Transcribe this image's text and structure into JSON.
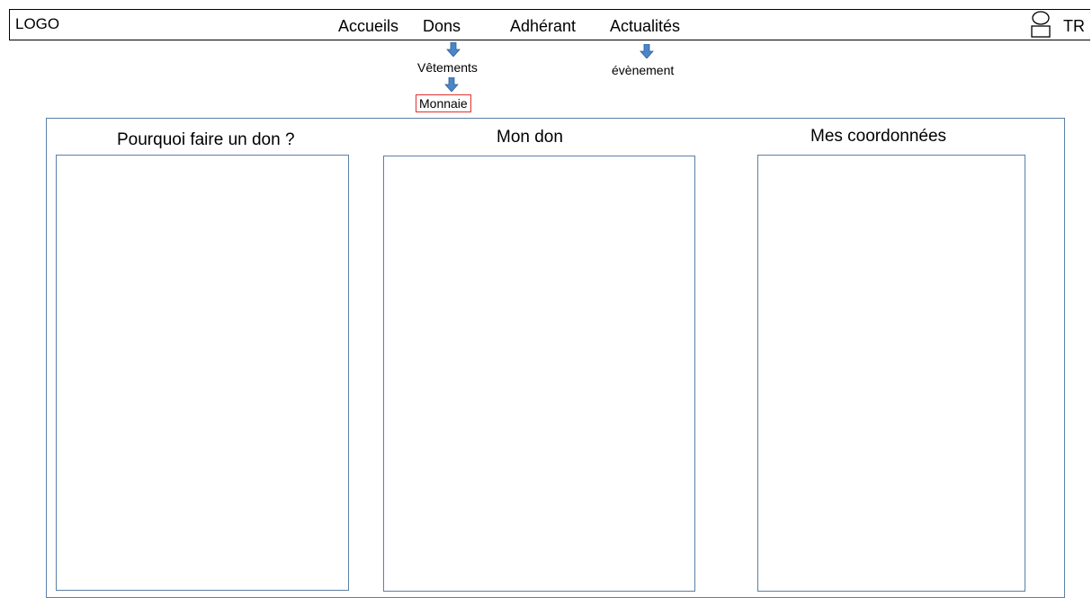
{
  "header": {
    "logo": "LOGO",
    "nav": {
      "accueils": "Accueils",
      "dons": "Dons",
      "adherant": "Adhérant",
      "actualites": "Actualités"
    },
    "user_label": "TR"
  },
  "submenus": {
    "dons": {
      "vetements": "Vêtements",
      "monnaie": "Monnaie"
    },
    "actualites": {
      "evenement": "évènement"
    }
  },
  "sections": {
    "pourquoi": "Pourquoi faire un don ?",
    "mon_don": "Mon don",
    "coordonnees": "Mes coordonnées"
  },
  "colors": {
    "arrow": "#4a86c8",
    "frame": "#5b7fa6",
    "selected_outline": "#e03030"
  },
  "icons": {
    "user": "user-icon",
    "arrow": "arrow-down-icon"
  }
}
